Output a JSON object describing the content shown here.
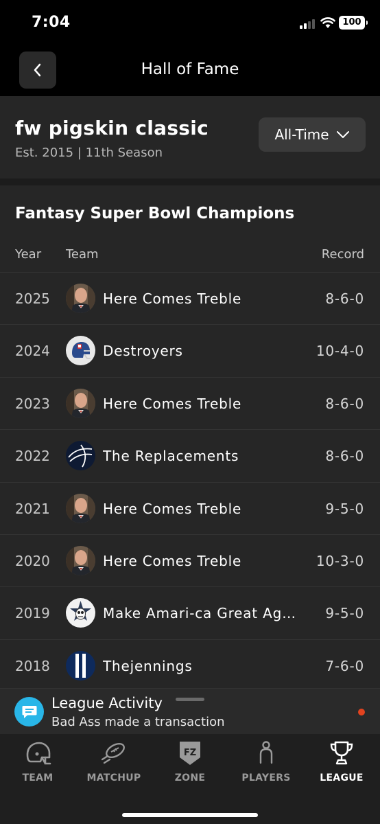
{
  "status": {
    "time": "7:04",
    "battery": "100"
  },
  "nav": {
    "title": "Hall of Fame"
  },
  "league": {
    "name": "fw pigskin classic",
    "subtitle": "Est. 2015 | 11th Season",
    "filter": "All-Time"
  },
  "champions": {
    "title": "Fantasy Super Bowl Champions",
    "headers": {
      "year": "Year",
      "team": "Team",
      "record": "Record"
    },
    "rows": [
      {
        "year": "2025",
        "team": "Here Comes Treble",
        "record": "8-6-0",
        "avatar": "person-photo"
      },
      {
        "year": "2024",
        "team": "Destroyers",
        "record": "10-4-0",
        "avatar": "football-helmet"
      },
      {
        "year": "2023",
        "team": "Here Comes Treble",
        "record": "8-6-0",
        "avatar": "person-photo"
      },
      {
        "year": "2022",
        "team": "The Replacements",
        "record": "8-6-0",
        "avatar": "football-logo"
      },
      {
        "year": "2021",
        "team": "Here Comes Treble",
        "record": "9-5-0",
        "avatar": "person-photo"
      },
      {
        "year": "2020",
        "team": "Here Comes Treble",
        "record": "10-3-0",
        "avatar": "person-photo"
      },
      {
        "year": "2019",
        "team": "Make Amari-ca Great Ag…",
        "record": "9-5-0",
        "avatar": "star-skull"
      },
      {
        "year": "2018",
        "team": "Thejennings",
        "record": "7-6-0",
        "avatar": "stripes"
      }
    ]
  },
  "activity": {
    "title": "League Activity",
    "text": "Bad Ass made a transaction"
  },
  "tabs": [
    {
      "label": "TEAM",
      "icon": "helmet-icon",
      "active": false
    },
    {
      "label": "MATCHUP",
      "icon": "football-icon",
      "active": false
    },
    {
      "label": "ZONE",
      "icon": "fz-shield-icon",
      "active": false
    },
    {
      "label": "PLAYERS",
      "icon": "player-icon",
      "active": false
    },
    {
      "label": "LEAGUE",
      "icon": "trophy-icon",
      "active": true
    }
  ],
  "colors": {
    "accent": "#29b6e8",
    "notification": "#e2431f",
    "background": "#262626"
  }
}
